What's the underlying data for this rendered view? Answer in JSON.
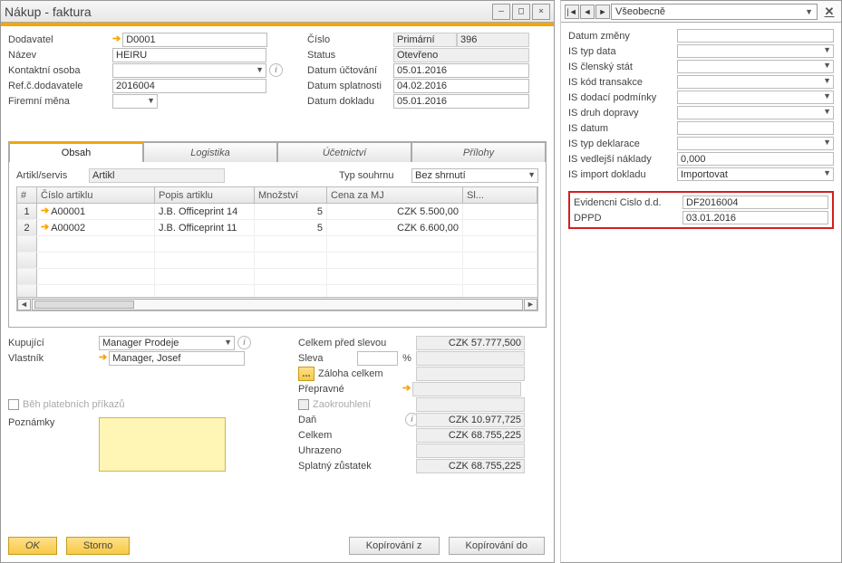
{
  "window": {
    "title": "Nákup - faktura"
  },
  "header": {
    "supplier_label": "Dodavatel",
    "supplier_value": "D0001",
    "name_label": "Název",
    "name_value": "HEIRU",
    "contact_label": "Kontaktní osoba",
    "contact_value": "",
    "refnum_label": "Ref.č.dodavatele",
    "refnum_value": "2016004",
    "currency_label": "Firemní měna",
    "currency_value": "",
    "number_label": "Číslo",
    "number_type": "Primární",
    "number_value": "396",
    "status_label": "Status",
    "status_value": "Otevřeno",
    "posting_label": "Datum účtování",
    "posting_value": "05.01.2016",
    "due_label": "Datum splatnosti",
    "due_value": "04.02.2016",
    "doc_label": "Datum dokladu",
    "doc_value": "05.01.2016"
  },
  "tabs": {
    "content": "Obsah",
    "logistics": "Logistika",
    "accounting": "Účetnictví",
    "attachments": "Přílohy"
  },
  "grid_top": {
    "item_label": "Artikl/servis",
    "item_value": "Artikl",
    "summary_label": "Typ souhrnu",
    "summary_value": "Bez shrnutí"
  },
  "grid": {
    "headers": {
      "num": "#",
      "item_no": "Číslo artiklu",
      "item_desc": "Popis artiklu",
      "qty": "Množství",
      "price": "Cena za MJ",
      "disc": "Sl..."
    },
    "rows": [
      {
        "num": "1",
        "item_no": "A00001",
        "item_desc": "J.B. Officeprint 14",
        "qty": "5",
        "price": "CZK 5.500,00",
        "disc": ""
      },
      {
        "num": "2",
        "item_no": "A00002",
        "item_desc": "J.B. Officeprint 11",
        "qty": "5",
        "price": "CZK 6.600,00",
        "disc": ""
      }
    ]
  },
  "footer": {
    "buyer_label": "Kupující",
    "buyer_value": "Manager Prodeje",
    "owner_label": "Vlastník",
    "owner_value": "Manager, Josef",
    "payment_orders_label": "Běh platebních příkazů",
    "remarks_label": "Poznámky",
    "total_before_label": "Celkem před slevou",
    "total_before_value": "CZK 57.777,500",
    "discount_label": "Sleva",
    "discount_pct": "",
    "pct_sign": "%",
    "downpay_label": "Záloha celkem",
    "downpay_value": "",
    "freight_label": "Přepravné",
    "freight_value": "",
    "rounding_label": "Zaokrouhlení",
    "rounding_value": "",
    "tax_label": "Daň",
    "tax_value": "CZK 10.977,725",
    "total_label": "Celkem",
    "total_value": "CZK 68.755,225",
    "paid_label": "Uhrazeno",
    "paid_value": "",
    "balance_label": "Splatný zůstatek",
    "balance_value": "CZK 68.755,225"
  },
  "buttons": {
    "ok": "OK",
    "cancel": "Storno",
    "copy_from": "Kopírování z",
    "copy_to": "Kopírování do"
  },
  "side": {
    "category": "Všeobecně",
    "rows": {
      "r1_l": "Datum změny",
      "r1_v": "",
      "r2_l": "IS typ data",
      "r2_v": "",
      "r3_l": "IS členský stát",
      "r3_v": "",
      "r4_l": "IS kód transakce",
      "r4_v": "",
      "r5_l": "IS dodací podmínky",
      "r5_v": "",
      "r6_l": "IS druh dopravy",
      "r6_v": "",
      "r7_l": "IS datum",
      "r7_v": "",
      "r8_l": "IS typ deklarace",
      "r8_v": "",
      "r9_l": "IS vedlejší náklady",
      "r9_v": "0,000",
      "r10_l": "IS import dokladu",
      "r10_v": "Importovat"
    },
    "highlight": {
      "h1_l": "Evidencni Cislo d.d.",
      "h1_v": "DF2016004",
      "h2_l": "DPPD",
      "h2_v": "03.01.2016"
    }
  }
}
